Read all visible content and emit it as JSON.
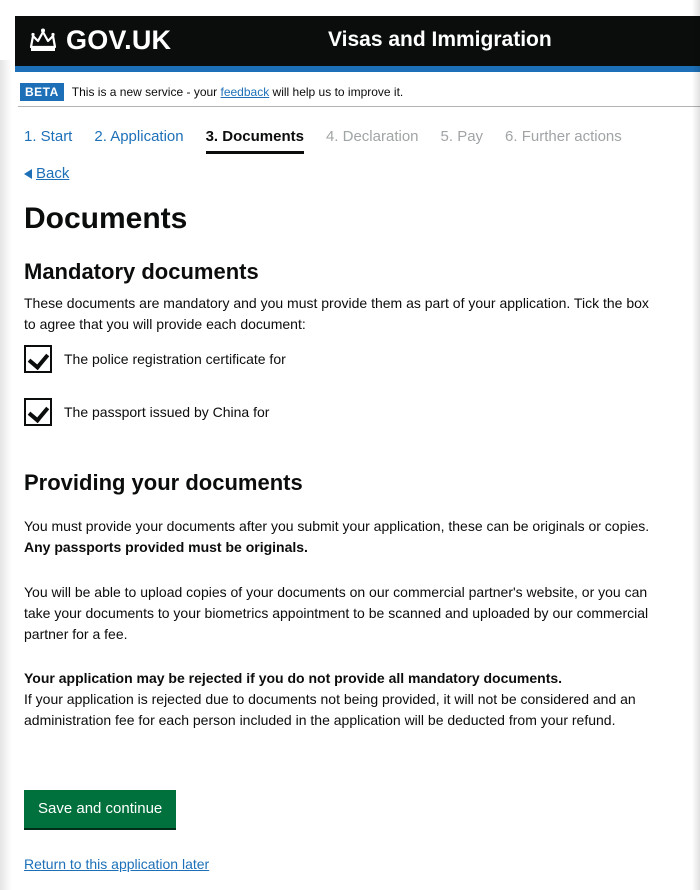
{
  "header": {
    "logo_text": "GOV.UK",
    "service_name": "Visas and Immigration"
  },
  "phase_banner": {
    "tag": "BETA",
    "text_before": "This is a new service - your ",
    "link_text": "feedback",
    "text_after": " will help us to improve it."
  },
  "steps": [
    {
      "label": "1. Start",
      "state": "done"
    },
    {
      "label": "2. Application",
      "state": "done"
    },
    {
      "label": "3. Documents",
      "state": "current"
    },
    {
      "label": "4. Declaration",
      "state": "future"
    },
    {
      "label": "5. Pay",
      "state": "future"
    },
    {
      "label": "6. Further actions",
      "state": "future"
    }
  ],
  "back_link": "Back",
  "page_title": "Documents",
  "mandatory": {
    "heading": "Mandatory documents",
    "intro": "These documents are mandatory and you must provide them as part of your application. Tick the box to agree that you will provide each document:",
    "items": [
      {
        "label": "The police registration certificate for",
        "checked": true
      },
      {
        "label": "The passport issued by China for",
        "checked": true
      }
    ]
  },
  "providing": {
    "heading": "Providing your documents",
    "para1_text": "You must provide your documents after you submit your application, these can be originals or copies. ",
    "para1_bold": "Any passports provided must be originals.",
    "para2": "You will be able to upload copies of your documents on our commercial partner's website, or you can take your documents to your biometrics appointment to be scanned and uploaded by our commercial partner for a fee.",
    "para3_bold": "Your application may be rejected if you do not provide all mandatory documents.",
    "para3_text": "If your application is rejected due to documents not being provided, it will not be considered and an administration fee for each person included in the application will be deducted from your refund."
  },
  "actions": {
    "save_label": "Save and continue",
    "return_label": "Return to this application later"
  },
  "colors": {
    "header_bg": "#0b0c0c",
    "brand_blue": "#1d70b8",
    "button_green": "#00703c",
    "future_step_grey": "#a0a4a6"
  },
  "icons": {
    "crown": "crown-icon",
    "back": "back-arrow-icon",
    "check": "checkmark-icon"
  }
}
